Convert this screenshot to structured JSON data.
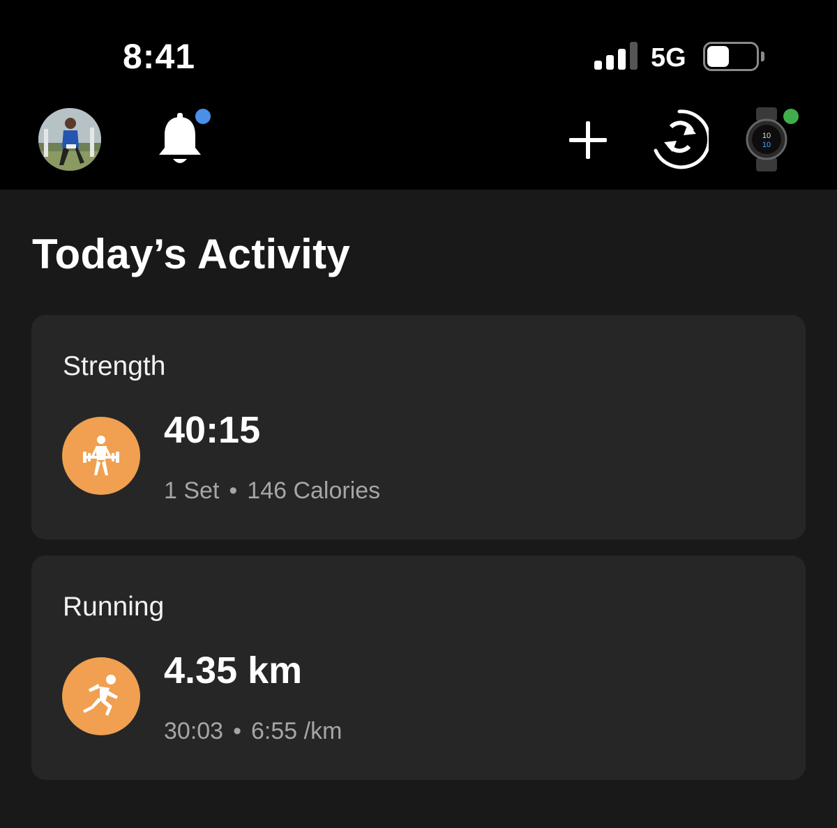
{
  "status_bar": {
    "time": "8:41",
    "network": "5G",
    "signal_bars_active": 3,
    "signal_bars_total": 4,
    "battery_level": 0.45
  },
  "header": {
    "avatar_icon": "profile-photo",
    "notifications_icon": "bell-icon",
    "notification_dot_color": "#4a8fe8",
    "add_icon": "plus-icon",
    "sync_icon": "sync-icon",
    "device_icon": "watch-icon",
    "device_status_color": "#3fae4b"
  },
  "page": {
    "title": "Today’s Activity"
  },
  "activities": [
    {
      "type": "Strength",
      "icon": "weightlifting-icon",
      "primary": "40:15",
      "meta": [
        "1 Set",
        "146 Calories"
      ]
    },
    {
      "type": "Running",
      "icon": "running-icon",
      "primary": "4.35 km",
      "meta": [
        "30:03",
        "6:55 /km"
      ]
    }
  ],
  "colors": {
    "background": "#191919",
    "card": "#262626",
    "accent": "#f0a050"
  },
  "separator": "•"
}
